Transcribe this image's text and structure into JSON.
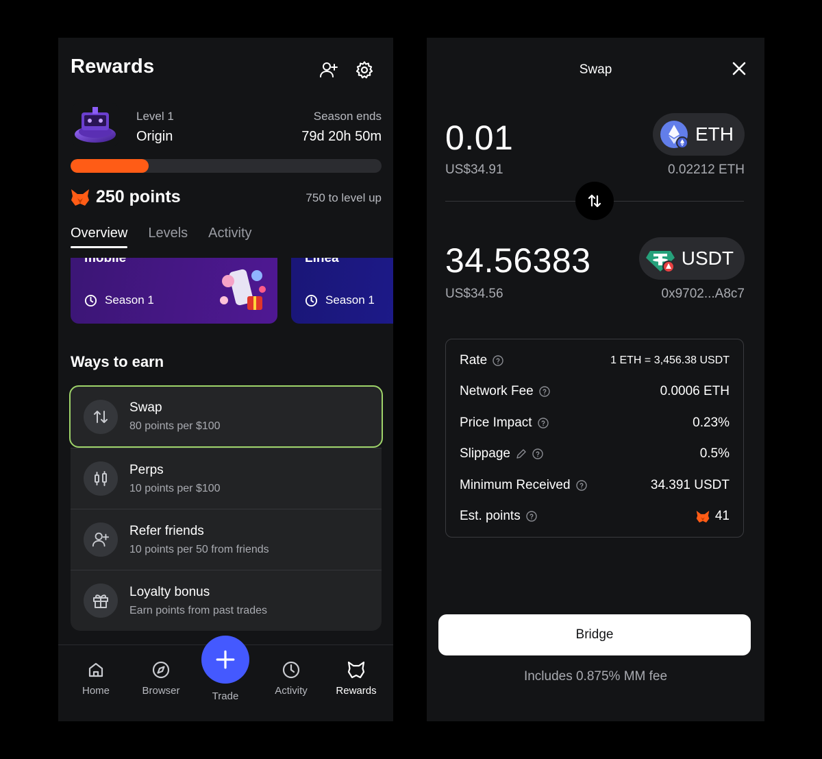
{
  "left": {
    "title": "Rewards",
    "level": {
      "label": "Level 1",
      "name": "Origin"
    },
    "season": {
      "label": "Season ends",
      "value": "79d 20h 50m"
    },
    "progress": {
      "fraction": 0.25,
      "color": "#ff5c16"
    },
    "points": "250 points",
    "to_level_up": "750 to level up",
    "tabs": [
      {
        "label": "Overview",
        "active": true
      },
      {
        "label": "Levels",
        "active": false
      },
      {
        "label": "Activity",
        "active": false
      }
    ],
    "promos": [
      {
        "title": "mobile",
        "season": "Season 1"
      },
      {
        "title": "Linea",
        "season": "Season 1"
      }
    ],
    "ways_title": "Ways to earn",
    "earn": [
      {
        "icon": "swap-arrows-icon",
        "name": "Swap",
        "desc": "80 points per $100",
        "selected": true
      },
      {
        "icon": "candlestick-icon",
        "name": "Perps",
        "desc": "10 points per $100",
        "selected": false
      },
      {
        "icon": "add-user-icon",
        "name": "Refer friends",
        "desc": "10 points per 50 from friends",
        "selected": false
      },
      {
        "icon": "gift-icon",
        "name": "Loyalty bonus",
        "desc": "Earn points from past trades",
        "selected": false
      }
    ],
    "nav": [
      {
        "label": "Home",
        "icon": "home-icon"
      },
      {
        "label": "Browser",
        "icon": "compass-icon"
      },
      {
        "label": "Trade",
        "icon": "plus-icon"
      },
      {
        "label": "Activity",
        "icon": "clock-icon"
      },
      {
        "label": "Rewards",
        "icon": "fox-rewards-icon",
        "active": true
      }
    ],
    "colors": {
      "accent_orange": "#ff5c16",
      "trade_blue": "#4459ff",
      "selected_border": "#9fd46a"
    }
  },
  "right": {
    "title": "Swap",
    "from": {
      "amount": "0.01",
      "fiat": "US$34.91",
      "token": "ETH",
      "balance": "0.02212 ETH"
    },
    "to": {
      "amount": "34.56383",
      "fiat": "US$34.56",
      "token": "USDT",
      "address": "0x9702...A8c7"
    },
    "details": [
      {
        "label": "Rate",
        "value": "1 ETH = 3,456.38 USDT"
      },
      {
        "label": "Network Fee",
        "value": "0.0006 ETH"
      },
      {
        "label": "Price Impact",
        "value": "0.23%"
      },
      {
        "label": "Slippage",
        "value": "0.5%"
      },
      {
        "label": "Minimum Received",
        "value": "34.391 USDT"
      },
      {
        "label": "Est. points",
        "value": "41"
      }
    ],
    "button": "Bridge",
    "fee_note": "Includes 0.875% MM fee"
  }
}
